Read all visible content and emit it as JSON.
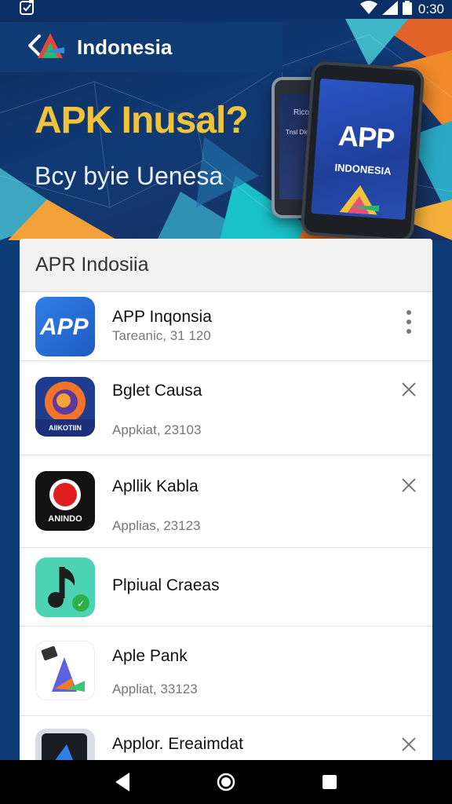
{
  "status_bar": {
    "time": "0:30"
  },
  "banner": {
    "brand": "Indonesia",
    "title": "APK Inusal?",
    "subtitle": "Bcy byie Uenesa",
    "phone_front_title": "APP",
    "phone_front_sub": "INDONESIA",
    "phone_back_title": "Ricot",
    "phone_back_sub": "Tnsl Dlenvitan"
  },
  "card": {
    "header": "APR Indosiia",
    "apps": [
      {
        "name": "APP Inqonsia",
        "sub": "Tareanic, 31 120",
        "action": "more",
        "icon": "app-logo-icon"
      },
      {
        "name": "Bglet Causa",
        "sub": "Appkiat, 23103",
        "action": "close",
        "icon": "firefox-style-icon",
        "icon_text": "AIIKOTIIN"
      },
      {
        "name": "Apllik Kabla",
        "sub": "Applias, 23123",
        "action": "close",
        "icon": "record-icon",
        "icon_text": "ANINDO"
      },
      {
        "name": "Plpiual Craeas",
        "sub": "",
        "action": "none",
        "icon": "music-note-icon"
      },
      {
        "name": "Aple Pank",
        "sub": "Appliat, 33123",
        "action": "none",
        "icon": "triangle-logo-icon"
      },
      {
        "name": "Applor. Ereaimdat",
        "sub": "",
        "action": "close",
        "icon": "tablet-app-icon"
      }
    ]
  },
  "colors": {
    "accent_blue": "#2b6fd6",
    "title_gold": "#f0c33c",
    "background": "#0d3b78"
  }
}
